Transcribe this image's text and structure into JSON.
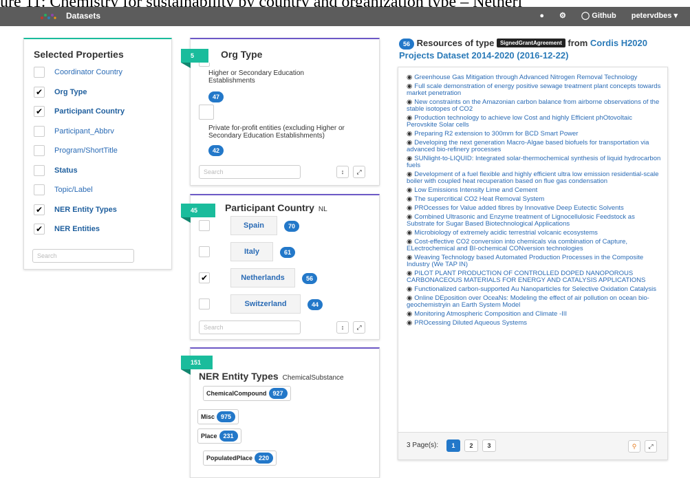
{
  "caption": "ure 11: Chemistry for sustainability by country and organization type – Netherl",
  "nav": {
    "datasets": "Datasets",
    "github": "Github",
    "user": "petervdbes"
  },
  "selected_properties": {
    "title": "Selected Properties",
    "items": [
      {
        "label": "Coordinator Country",
        "checked": false
      },
      {
        "label": "Org Type",
        "checked": true
      },
      {
        "label": "Participant Country",
        "checked": true
      },
      {
        "label": "Participant_Abbrv",
        "checked": false
      },
      {
        "label": "Program/ShortTitle",
        "checked": false
      },
      {
        "label": "Status",
        "checked": false
      },
      {
        "label": "Topic/Label",
        "checked": false
      },
      {
        "label": "NER Entity Types",
        "checked": true
      },
      {
        "label": "NER Entities",
        "checked": true
      }
    ],
    "search_placeholder": "Search"
  },
  "org_type": {
    "count": "5",
    "title": "Org Type",
    "items": [
      {
        "label": "Higher or Secondary Education Establishments",
        "count": "47"
      },
      {
        "label": "Private for-profit entities (excluding Higher or Secondary Education Establishments)",
        "count": "42"
      }
    ],
    "search_placeholder": "Search"
  },
  "participant_country": {
    "count": "45",
    "title": "Participant Country",
    "selected": "NL",
    "items": [
      {
        "label": "Spain",
        "count": "70",
        "checked": false
      },
      {
        "label": "Italy",
        "count": "61",
        "checked": false
      },
      {
        "label": "Netherlands",
        "count": "56",
        "checked": true
      },
      {
        "label": "Switzerland",
        "count": "44",
        "checked": false
      }
    ],
    "search_placeholder": "Search"
  },
  "ner_types": {
    "count": "151",
    "title": "NER Entity Types",
    "selected": "ChemicalSubstance",
    "items": [
      {
        "label": "ChemicalCompound",
        "count": "927"
      },
      {
        "label": "Misc",
        "count": "975"
      },
      {
        "label": "Place",
        "count": "231"
      },
      {
        "label": "PopulatedPlace",
        "count": "220"
      }
    ]
  },
  "resources": {
    "count": "56",
    "prefix": "Resources of type",
    "type": "SignedGrantAgreement",
    "from": "from",
    "source": "Cordis H2020 Projects Dataset 2014-2020 (2016-12-22)",
    "items": [
      "Greenhouse Gas Mitigation through Advanced Nitrogen Removal Technology",
      "Full scale demonstration of energy positive sewage treatment plant concepts towards market penetration",
      "New constraints on the Amazonian carbon balance from airborne observations of the stable isotopes of CO2",
      "Production technology to achieve low Cost and highly Efficient phOtovoltaic Perovskite Solar cells",
      "Preparing R2 extension to 300mm for BCD Smart Power",
      "Developing the next generation Macro-Algae based biofuels for transportation via advanced bio-refinery processes",
      "SUNlight-to-LIQUID: Integrated solar-thermochemical synthesis of liquid hydrocarbon fuels",
      "Development of a fuel flexible and highly efficient ultra low emission residential-scale boiler with coupled heat recuperation based on flue gas condensation",
      "Low Emissions Intensity Lime and Cement",
      "The supercritical CO2 Heat Removal System",
      "PROcesses for Value added fibres by Innovative Deep Eutectic Solvents",
      "Combined Ultrasonic and Enzyme treatment of Lignocellulosic Feedstock as Substrate for Sugar Based Biotechnological Applications",
      "Microbiology of extremely acidic terrestrial volcanic ecosystems",
      "Cost-effective CO2 conversion into chemicals via combination of Capture, ELectrochemical and BI-ochemical CONversion technologies",
      "Weaving Technology based Automated Production Processes in the Composite Industry (We TAP IN)",
      "PILOT PLANT PRODUCTION OF CONTROLLED DOPED NANOPOROUS CARBONACEOUS MATERIALS FOR ENERGY AND CATALYSIS APPLICATIONS",
      "Functionalized carbon-supported Au Nanoparticles for Selective Oxidation Catalysis",
      "Online DEposition over OceaNs: Modeling the effect of air pollution on ocean bio-geochemistryin an Earth System Model",
      "Monitoring Atmospheric Composition and Climate -III",
      "PROcessing Diluted Aqueous Systems"
    ],
    "pages_label": "3 Page(s):",
    "pages": [
      "1",
      "2",
      "3"
    ]
  }
}
